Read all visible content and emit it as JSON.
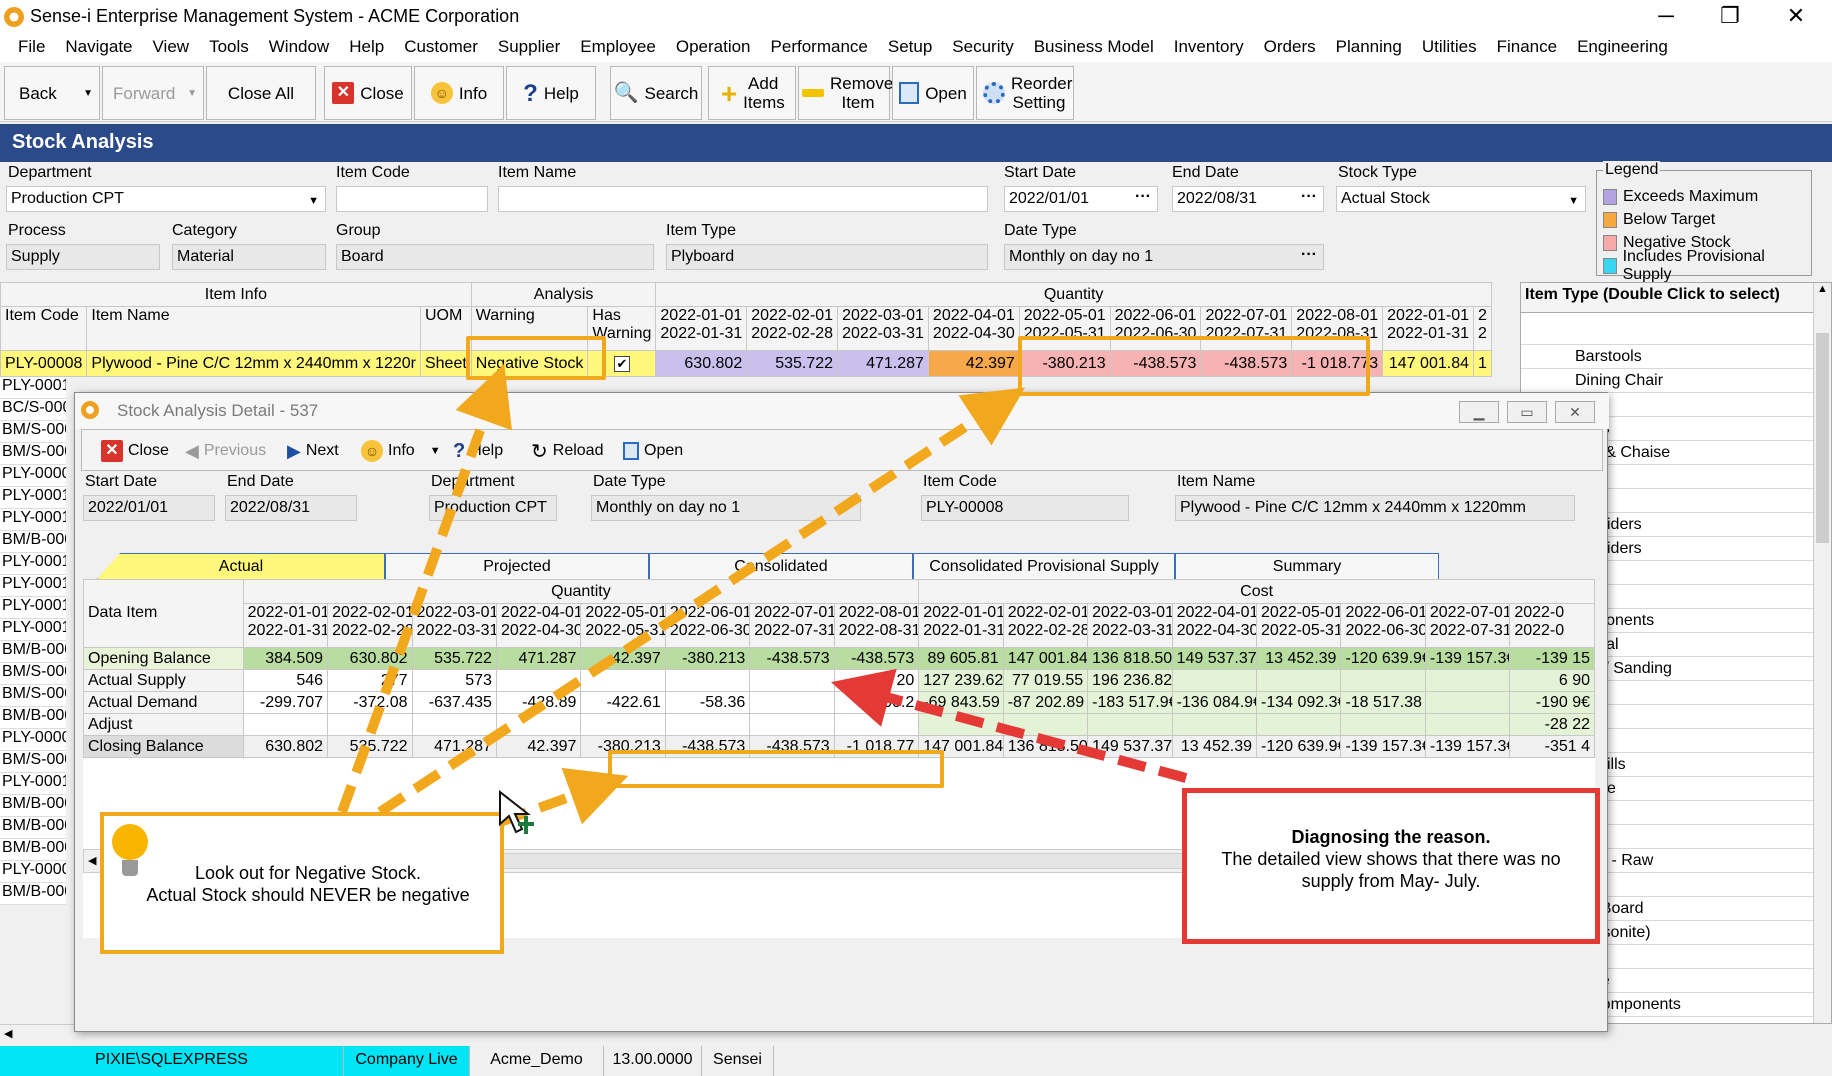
{
  "window": {
    "title": "Sense-i Enterprise Management System - ACME Corporation",
    "controls": [
      "─",
      "❐",
      "✕"
    ]
  },
  "menu": [
    "File",
    "Navigate",
    "View",
    "Tools",
    "Window",
    "Help",
    "Customer",
    "Supplier",
    "Employee",
    "Operation",
    "Performance",
    "Setup",
    "Security",
    "Business Model",
    "Inventory",
    "Orders",
    "Planning",
    "Utilities",
    "Finance",
    "Engineering"
  ],
  "toolbar": {
    "back": "Back",
    "forward": "Forward",
    "close_all": "Close All",
    "close": "Close",
    "info": "Info",
    "help": "Help",
    "search": "Search",
    "add_items": "Add Items",
    "remove_item": "Remove Item",
    "open": "Open",
    "reorder_setting": "Reorder Setting"
  },
  "header": {
    "title": "Stock Analysis"
  },
  "filters": {
    "department": {
      "label": "Department",
      "value": "Production CPT"
    },
    "item_code": {
      "label": "Item Code",
      "value": ""
    },
    "item_name": {
      "label": "Item Name",
      "value": ""
    },
    "start_date": {
      "label": "Start Date",
      "value": "2022/01/01"
    },
    "end_date": {
      "label": "End Date",
      "value": "2022/08/31"
    },
    "stock_type": {
      "label": "Stock Type",
      "value": "Actual Stock"
    },
    "process": {
      "label": "Process",
      "value": "Supply"
    },
    "category": {
      "label": "Category",
      "value": "Material"
    },
    "group": {
      "label": "Group",
      "value": "Board"
    },
    "item_type": {
      "label": "Item Type",
      "value": "Plyboard"
    },
    "date_type": {
      "label": "Date Type",
      "value": "Monthly on day no 1"
    }
  },
  "legend": {
    "title": "Legend",
    "items": [
      {
        "label": "Exceeds Maximum",
        "color": "#b3a3e0"
      },
      {
        "label": "Below Target",
        "color": "#f5a840"
      },
      {
        "label": "Negative Stock",
        "color": "#f7a8a8"
      },
      {
        "label": "Includes Provisional Supply",
        "color": "#38d6f0"
      }
    ]
  },
  "main_grid": {
    "group_headers": {
      "item_info": "Item Info",
      "analysis": "Analysis",
      "quantity": "Quantity"
    },
    "col_headers": {
      "item_code": "Item Code",
      "item_name": "Item Name",
      "uom": "UOM",
      "warning": "Warning",
      "has_warning": "Has Warning"
    },
    "periods": [
      {
        "s": "2022-01-01",
        "e": "2022-01-31"
      },
      {
        "s": "2022-02-01",
        "e": "2022-02-28"
      },
      {
        "s": "2022-03-01",
        "e": "2022-03-31"
      },
      {
        "s": "2022-04-01",
        "e": "2022-04-30"
      },
      {
        "s": "2022-05-01",
        "e": "2022-05-31"
      },
      {
        "s": "2022-06-01",
        "e": "2022-06-30"
      },
      {
        "s": "2022-07-01",
        "e": "2022-07-31"
      },
      {
        "s": "2022-08-01",
        "e": "2022-08-31"
      },
      {
        "s": "2022-01-01",
        "e": "2022-01-31"
      },
      {
        "s": "2",
        "e": "2"
      }
    ],
    "selected_row": {
      "item_code": "PLY-00008",
      "item_name": "Plywood - Pine C/C 12mm x 2440mm x 1220r",
      "uom": "Sheet",
      "warning": "Negative Stock",
      "has_warning": "✔",
      "values": [
        "630.802",
        "535.722",
        "471.287",
        "42.397",
        "-380.213",
        "-438.573",
        "-438.573",
        "-1 018.773",
        "147 001.84",
        "1"
      ]
    },
    "other_codes": [
      "PLY-00015",
      "BC/S-0000",
      "BM/S-000",
      "BM/S-000",
      "PLY-00005",
      "PLY-0001",
      "PLY-00012",
      "BM/B-000",
      "PLY-00013",
      "PLY-0001",
      "PLY-00016",
      "PLY-00017",
      "BM/B-000",
      "BM/S-000",
      "BM/S-000",
      "BM/B-000",
      "PLY-00006",
      "BM/S-000",
      "PLY-0001",
      "BM/B-000",
      "BM/B-000",
      "BM/B-000",
      "PLY-00007",
      "BM/B-000"
    ]
  },
  "right_panel": {
    "title": "Item Type (Double Click to select)",
    "items": [
      "Barstools",
      "Dining Chair",
      "oods",
      "oods",
      "ans & Chaise",
      "r",
      "an",
      "/ Dividers",
      "/ Dividers",
      "",
      "",
      "omponents",
      "aterial",
      "ves / Sanding",
      "aper",
      "ives",
      "",
      "& Drills",
      "Blade",
      "s",
      "",
      "oard - Raw",
      "Raw",
      "ine Board",
      "(Masonite)",
      "rd",
      "Core",
      "& Components"
    ]
  },
  "status": {
    "server": "PIXIE\\SQLEXPRESS",
    "company": "Company Live",
    "db": "Acme_Demo",
    "version": "13.00.0000",
    "user": "Sensei"
  },
  "dialog": {
    "title": "Stock Analysis Detail - 537",
    "toolbar": {
      "close": "Close",
      "previous": "Previous",
      "next": "Next",
      "info": "Info",
      "help": "Help",
      "reload": "Reload",
      "open": "Open"
    },
    "fields": {
      "start_date": {
        "label": "Start Date",
        "value": "2022/01/01"
      },
      "end_date": {
        "label": "End Date",
        "value": "2022/08/31"
      },
      "department": {
        "label": "Department",
        "value": "Production CPT"
      },
      "date_type": {
        "label": "Date Type",
        "value": "Monthly on day no 1"
      },
      "item_code": {
        "label": "Item Code",
        "value": "PLY-00008"
      },
      "item_name": {
        "label": "Item Name",
        "value": "Plywood - Pine C/C 12mm x 2440mm x 1220mm"
      }
    },
    "tabs": [
      "Actual",
      "Projected",
      "Consolidated",
      "Consolidated Provisional Supply",
      "Summary"
    ],
    "grid": {
      "group_quantity": "Quantity",
      "group_cost": "Cost",
      "data_item_header": "Data Item",
      "periods": [
        {
          "s": "2022-01-01",
          "e": "2022-01-31"
        },
        {
          "s": "2022-02-01",
          "e": "2022-02-28"
        },
        {
          "s": "2022-03-01",
          "e": "2022-03-31"
        },
        {
          "s": "2022-04-01",
          "e": "2022-04-30"
        },
        {
          "s": "2022-05-01",
          "e": "2022-05-31"
        },
        {
          "s": "2022-06-01",
          "e": "2022-06-30"
        },
        {
          "s": "2022-07-01",
          "e": "2022-07-31"
        },
        {
          "s": "2022-08-01",
          "e": "2022-08-31"
        },
        {
          "s": "2022-01-01",
          "e": "2022-01-31"
        },
        {
          "s": "2022-02-01",
          "e": "2022-02-28"
        },
        {
          "s": "2022-03-01",
          "e": "2022-03-31"
        },
        {
          "s": "2022-04-01",
          "e": "2022-04-30"
        },
        {
          "s": "2022-05-01",
          "e": "2022-05-31"
        },
        {
          "s": "2022-06-01",
          "e": "2022-06-30"
        },
        {
          "s": "2022-07-01",
          "e": "2022-07-31"
        },
        {
          "s": "2022-0",
          "e": "2022-0"
        }
      ],
      "rows": [
        {
          "label": "Opening Balance",
          "values": [
            "384.509",
            "630.802",
            "535.722",
            "471.287",
            "42.397",
            "-380.213",
            "-438.573",
            "-438.573",
            "89 605.81",
            "147 001.84",
            "136 818.50",
            "149 537.37",
            "13 452.39",
            "-120 639.9€",
            "-139 157.3€",
            "-139 15"
          ]
        },
        {
          "label": "Actual Supply",
          "values": [
            "546",
            "277",
            "573",
            "",
            "",
            "",
            "",
            "20",
            "127 239.62",
            "77 019.55",
            "196 236.82",
            "",
            "",
            "",
            "",
            "6 90"
          ]
        },
        {
          "label": "Actual Demand",
          "values": [
            "-299.707",
            "-372.08",
            "-637.435",
            "-428.89",
            "-422.61",
            "-58.36",
            "",
            "-600.2",
            "-69 843.59",
            "-87 202.89",
            "-183 517.9€",
            "-136 084.9€",
            "-134 092.3€",
            "-18 517.38",
            "",
            "-190 9€"
          ]
        },
        {
          "label": "Adjust",
          "values": [
            "",
            "",
            "",
            "",
            "",
            "",
            "",
            "",
            "",
            "",
            "",
            "",
            "",
            "",
            "",
            "-28 22"
          ]
        },
        {
          "label": "Closing Balance",
          "values": [
            "630.802",
            "535.722",
            "471.287",
            "42.397",
            "-380.213",
            "-438.573",
            "-438.573",
            "-1 018.77",
            "147 001.84",
            "136 818.50",
            "149 537.37",
            "13 452.39",
            "-120 639.9€",
            "-139 157.3€",
            "-139 157.3€",
            "-351 4"
          ]
        }
      ]
    }
  },
  "callouts": {
    "left": "Look out for Negative Stock.\nActual Stock should NEVER be negative",
    "right_title": "Diagnosing the reason.",
    "right_body": "The detailed view shows that there was no supply from May- July."
  }
}
